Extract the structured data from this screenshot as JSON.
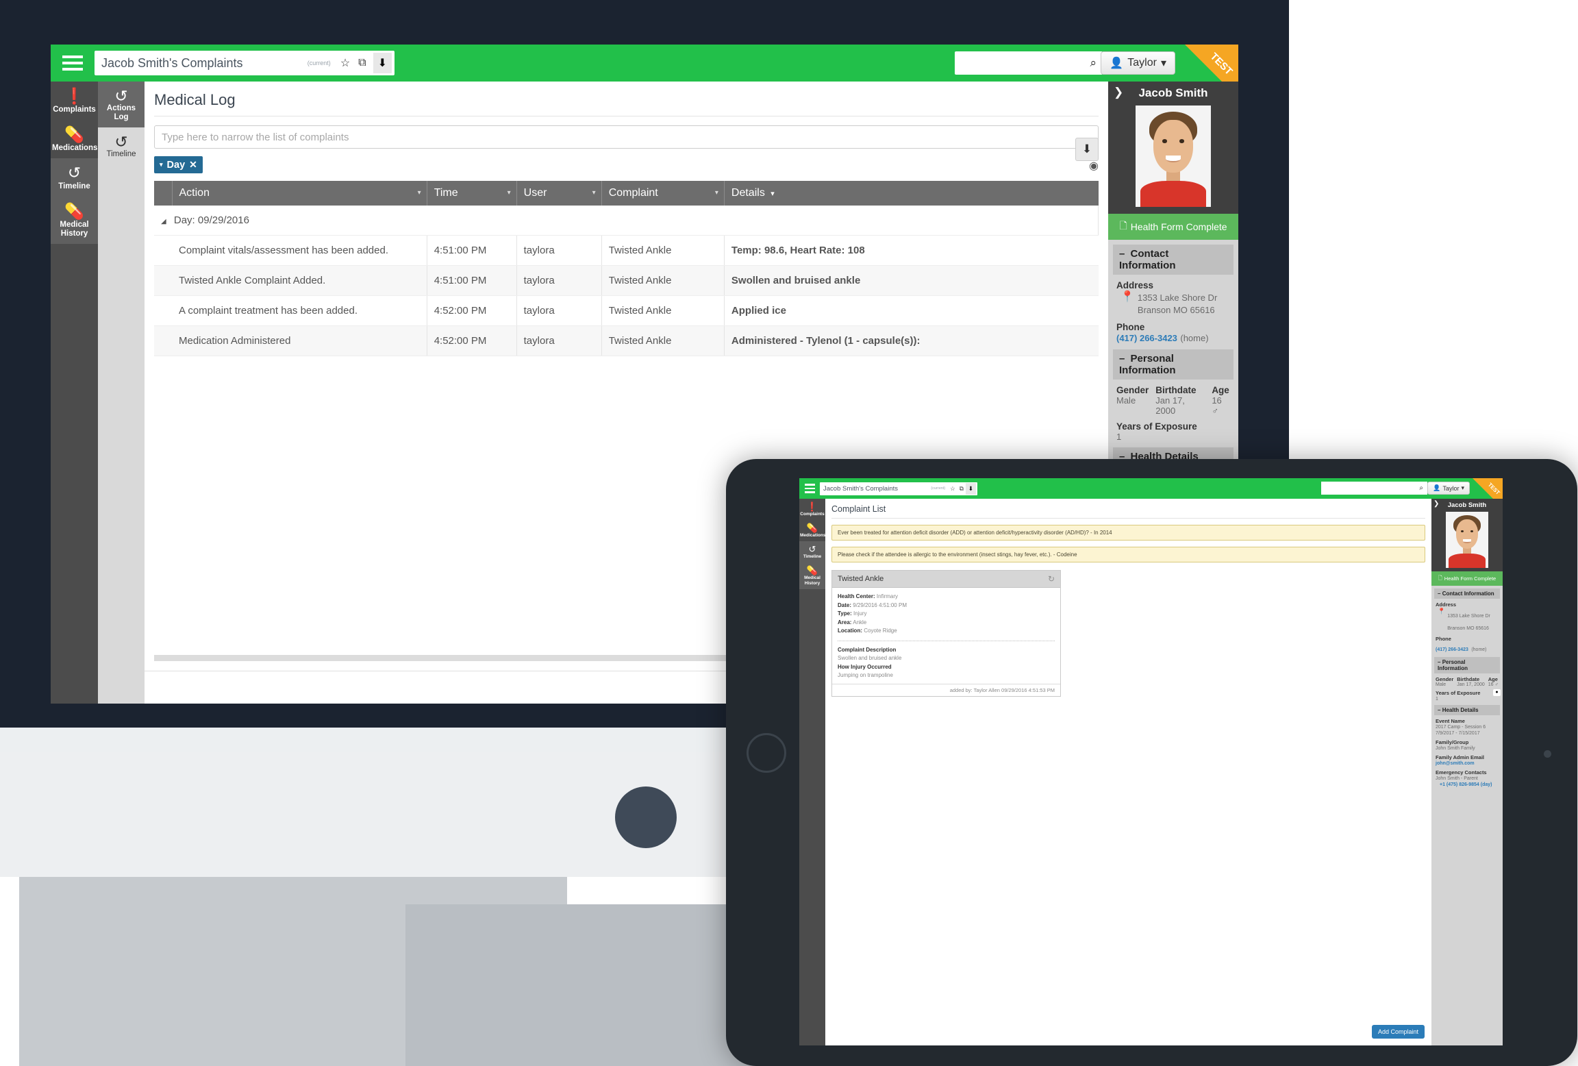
{
  "desktop": {
    "appbar": {
      "menu_icon": "hamburger-icon",
      "address_title": "Jacob Smith's Complaints",
      "address_current": "(current)",
      "star_icon": "☆",
      "popout_icon": "⧉",
      "download_icon": "⬇",
      "search_icon": "⌕",
      "search_value": "",
      "user_label": "Taylor",
      "user_caret": "▾",
      "test_flag": "TEST"
    },
    "leftnav": [
      {
        "label": "Complaints",
        "icon": "exclamation-circle-icon",
        "glyph": "❗"
      },
      {
        "label": "Medications",
        "icon": "medkit-icon",
        "glyph": "⚕"
      },
      {
        "label": "Timeline",
        "icon": "undo-icon",
        "glyph": "↺"
      },
      {
        "label": "Medical History",
        "icon": "medkit-icon",
        "glyph": "⚕"
      }
    ],
    "secondnav": [
      {
        "label": "Actions Log",
        "icon": "history-icon",
        "glyph": "↺"
      },
      {
        "label": "Timeline",
        "icon": "undo-icon",
        "glyph": "↺"
      }
    ],
    "main": {
      "page_title": "Medical Log",
      "filter_placeholder": "Type here to narrow the list of complaints",
      "download_icon": "⬇",
      "filter_chip": {
        "caret": "▾",
        "label": "Day",
        "close": "✕"
      },
      "eye_icon": "◉",
      "columns": [
        "Action",
        "Time",
        "User",
        "Complaint",
        "Details"
      ],
      "details_sort_caret": "▾",
      "group_label": "Day: 09/29/2016",
      "group_caret": "◢",
      "rows": [
        {
          "action": "Complaint vitals/assessment has been added.",
          "time": "4:51:00 PM",
          "user": "taylora",
          "complaint": "Twisted Ankle",
          "details": "Temp: 98.6, Heart Rate: 108"
        },
        {
          "action": "Twisted Ankle Complaint Added.",
          "time": "4:51:00 PM",
          "user": "taylora",
          "complaint": "Twisted Ankle",
          "details": "Swollen and bruised ankle"
        },
        {
          "action": "A complaint treatment has been added.",
          "time": "4:52:00 PM",
          "user": "taylora",
          "complaint": "Twisted Ankle",
          "details": "Applied ice"
        },
        {
          "action": "Medication Administered",
          "time": "4:52:00 PM",
          "user": "taylora",
          "complaint": "Twisted Ankle",
          "details": "Administered - Tylenol (1 - capsule(s)):"
        }
      ]
    },
    "rightpanel": {
      "collapse_icon": "❯",
      "person_name": "Jacob Smith",
      "health_form_label": "Health Form Complete",
      "health_form_icon": "὜e",
      "contact_section": "Contact Information",
      "address_label": "Address",
      "address_line1": "1353 Lake Shore Dr",
      "address_line2": "Branson MO 65616",
      "phone_label": "Phone",
      "phone_number": "(417) 266-3423",
      "phone_type": "(home)",
      "personal_section": "Personal Information",
      "gender_label": "Gender",
      "gender_value": "Male",
      "birthdate_label": "Birthdate",
      "birthdate_value": "Jan 17, 2000",
      "age_label": "Age",
      "age_value": "16",
      "age_icon": "♂",
      "years_label": "Years of Exposure",
      "years_value": "1",
      "health_section": "Health Details"
    }
  },
  "tablet": {
    "appbar": {
      "address_title": "Jacob Smith's Complaints",
      "address_current": "(current)",
      "star_icon": "☆",
      "popout_icon": "⧉",
      "download_icon": "⬇",
      "search_icon": "⌕",
      "search_value": "",
      "user_label": "Taylor",
      "user_caret": "▾",
      "test_flag": "TEST"
    },
    "leftnav": [
      {
        "label": "Complaints",
        "glyph": "❗"
      },
      {
        "label": "Medications",
        "glyph": "⚕"
      },
      {
        "label": "Timeline",
        "glyph": "↺"
      },
      {
        "label": "Medical History",
        "glyph": "⚕"
      }
    ],
    "main": {
      "page_title": "Complaint List",
      "alerts": [
        "Ever been treated for attention deficit disorder (ADD) or attention deficit/hyperactivity disorder (AD/HD)? - In 2014",
        "Please check if the attendee is allergic to the environment (insect stings, hay fever, etc.). - Codeine"
      ],
      "card": {
        "title": "Twisted Ankle",
        "refresh_icon": "↻",
        "fields": [
          {
            "label": "Health Center:",
            "value": "Infirmary"
          },
          {
            "label": "Date:",
            "value": "9/29/2016 4:51:00 PM"
          },
          {
            "label": "Type:",
            "value": "Injury"
          },
          {
            "label": "Area:",
            "value": "Ankle"
          },
          {
            "label": "Location:",
            "value": "Coyote Ridge"
          }
        ],
        "desc_label": "Complaint Description",
        "desc_value": "Swollen and bruised ankle",
        "how_label": "How Injury Occurred",
        "how_value": "Jumping on trampoline",
        "footer": "added by: Taylor Allen 09/29/2016 4:51:53 PM"
      },
      "add_complaint_label": "Add Complaint"
    },
    "rightpanel": {
      "collapse_icon": "❯",
      "person_name": "Jacob Smith",
      "health_form_label": "Health Form Complete",
      "health_form_icon": "὜e",
      "contact_section": "Contact Information",
      "address_label": "Address",
      "address_line1": "1353 Lake Shore Dr",
      "address_line2": "Branson MO 65616",
      "phone_label": "Phone",
      "phone_number": "(417) 266-3423",
      "phone_type": "(home)",
      "personal_section": "Personal Information",
      "gender_label": "Gender",
      "gender_value": "Male",
      "birthdate_label": "Birthdate",
      "birthdate_value": "Jan 17, 2000",
      "age_label": "Age",
      "age_value": "16",
      "age_icon": "♂",
      "years_label": "Years of Exposure",
      "years_value": "1",
      "health_section": "Health Details",
      "event_label": "Event Name",
      "event_value": "2017 Camp - Session 6",
      "event_dates": "7/9/2017 - 7/15/2017",
      "family_label": "Family/Group",
      "family_value": "John Smith Family",
      "admin_email_label": "Family Admin Email",
      "admin_email_value": "john@smith.com",
      "emergency_label": "Emergency Contacts",
      "emergency_name": "John Smith - Parent",
      "emergency_phone": "+1 (475) 826-9854 (day)",
      "chat_icon": "●"
    }
  },
  "colors": {
    "brand_green": "#22c04a",
    "accent_blue": "#246a94",
    "link_blue": "#1a6aa8",
    "warn_yellow": "#fcf4d2",
    "test_orange": "#f5a623",
    "header_grey": "#6d6d6d"
  }
}
